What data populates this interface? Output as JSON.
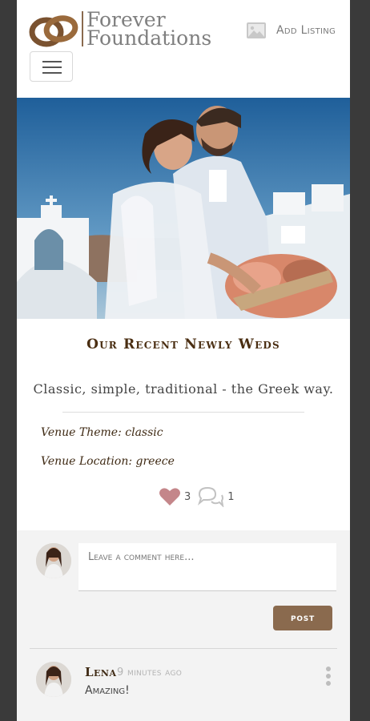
{
  "header": {
    "brand_line1": "Forever",
    "brand_line2": "Foundations",
    "add_listing_label": "Add Listing"
  },
  "post": {
    "title": "Our Recent Newly Weds",
    "caption": "Classic, simple, traditional - the Greek way.",
    "venue_theme": "Venue Theme: classic",
    "venue_location": "Venue Location: greece",
    "likes": "3",
    "comments": "1"
  },
  "comment_form": {
    "placeholder": "Leave a comment here...",
    "post_label": "post"
  },
  "comments": [
    {
      "author": "Lena",
      "time": "9 minutes ago",
      "text": "Amazing!"
    }
  ],
  "colors": {
    "brand_brown": "#8a6a4e",
    "title_brown": "#4a2e12",
    "heart": "#c4868a"
  },
  "icons": [
    "rings-logo-icon",
    "image-icon",
    "menu-icon",
    "heart-icon",
    "comments-icon",
    "more-options-icon"
  ]
}
